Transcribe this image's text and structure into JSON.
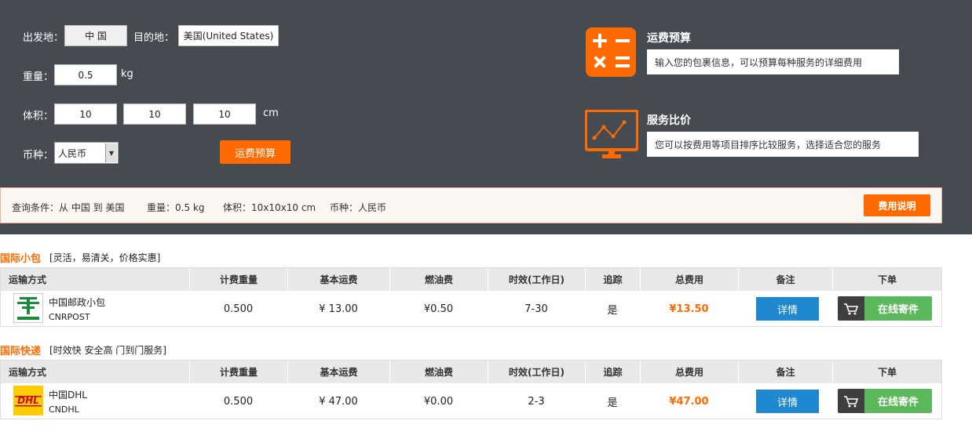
{
  "form": {
    "origin_label": "出发地：",
    "origin_value": "中 国",
    "dest_label": "目的地：",
    "dest_value": "美国(United States)",
    "weight_label": "重量：",
    "weight_value": "0.5",
    "weight_unit": "kg",
    "volume_label": "体积：",
    "volume_l": "10",
    "volume_w": "10",
    "volume_h": "10",
    "volume_unit": "cm",
    "currency_label": "币种：",
    "currency_value": "人民币",
    "estimate_button": "运费预算"
  },
  "features": [
    {
      "title": "运费预算",
      "desc": "输入您的包裹信息，可以预算每种服务的详细费用",
      "icon": "calculator-icon"
    },
    {
      "title": "服务比价",
      "desc": "您可以按费用等项目排序比较服务，选择适合您的服务",
      "icon": "monitor-chart-icon"
    }
  ],
  "summary": {
    "route": "查询条件：从 中国 到 美国",
    "weight": "重量：0.5  kg",
    "volume": "体积：10x10x10  cm",
    "currency": "币种：人民币",
    "fee_button": "费用说明"
  },
  "columns": [
    "运输方式",
    "计费重量",
    "基本运费",
    "燃油费",
    "时效(工作日)",
    "追踪",
    "总费用",
    "备注",
    "下单"
  ],
  "sections": [
    {
      "title": "国际小包",
      "subtitle": "[灵活，易清关，价格实惠]",
      "rows": [
        {
          "name": "中国邮政小包",
          "code": "CNRPOST",
          "logo": "china-post-logo",
          "weight": "0.500",
          "base": "¥  13.00",
          "fuel": "¥0.50",
          "days": "7-30",
          "track": "是",
          "total": "¥13.50",
          "detail": "详情",
          "ship": "在线寄件"
        }
      ]
    },
    {
      "title": "国际快递",
      "subtitle": "[时效快 安全高 门到门服务]",
      "rows": [
        {
          "name": "中国DHL",
          "code": "CNDHL",
          "logo": "dhl-logo",
          "weight": "0.500",
          "base": "¥  47.00",
          "fuel": "¥0.00",
          "days": "2-3",
          "track": "是",
          "total": "¥47.00",
          "detail": "详情",
          "ship": "在线寄件"
        }
      ]
    }
  ],
  "colors": {
    "accent": "#ff6a00",
    "header_bg": "#464b52",
    "detail_blue": "#1e88d0",
    "ship_green": "#5cb85c"
  }
}
